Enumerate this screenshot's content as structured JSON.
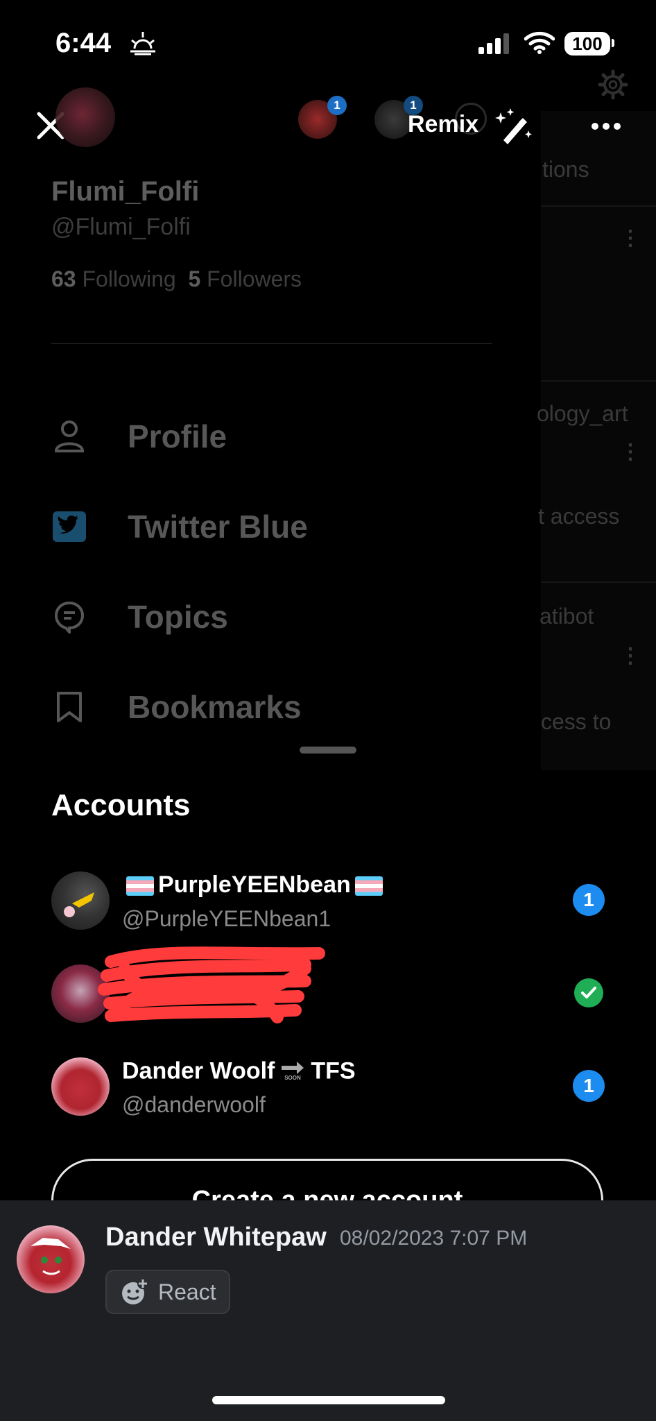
{
  "status_bar": {
    "time": "6:44",
    "battery": "100"
  },
  "background_timeline": {
    "snippets": [
      "tions",
      "ology_art",
      "t access",
      "atibot",
      "cess to"
    ]
  },
  "header": {
    "remix_label": "Remix",
    "notification_count_1": "1",
    "notification_count_2": "1"
  },
  "profile": {
    "display_name": "Flumi_Folfi",
    "handle": "@Flumi_Folfi",
    "following_count": "63",
    "following_label": "Following",
    "followers_count": "5",
    "followers_label": "Followers"
  },
  "menu": {
    "items": [
      {
        "label": "Profile",
        "icon": "person-icon"
      },
      {
        "label": "Twitter Blue",
        "icon": "twitter-blue-icon"
      },
      {
        "label": "Topics",
        "icon": "topics-icon"
      },
      {
        "label": "Bookmarks",
        "icon": "bookmark-icon"
      }
    ]
  },
  "accounts": {
    "title": "Accounts",
    "list": [
      {
        "name": "PurpleYEENbean",
        "handle": "@PurpleYEENbean1",
        "badge": "1"
      },
      {
        "name": "",
        "handle": "",
        "badge": "check"
      },
      {
        "name_left": "Dander Woolf",
        "name_right": "TFS",
        "soon": "SOON",
        "handle": "@danderwoolf",
        "badge": "1"
      }
    ],
    "create_button": "Create a new account"
  },
  "discord_message": {
    "author": "Dander Whitepaw",
    "timestamp": "08/02/2023 7:07 PM",
    "react_label": "React"
  },
  "colors": {
    "accent_blue": "#1d8cf0",
    "check_green": "#1fae56",
    "redaction_red": "#ff3b3b",
    "discord_bg": "#1e1f22"
  }
}
